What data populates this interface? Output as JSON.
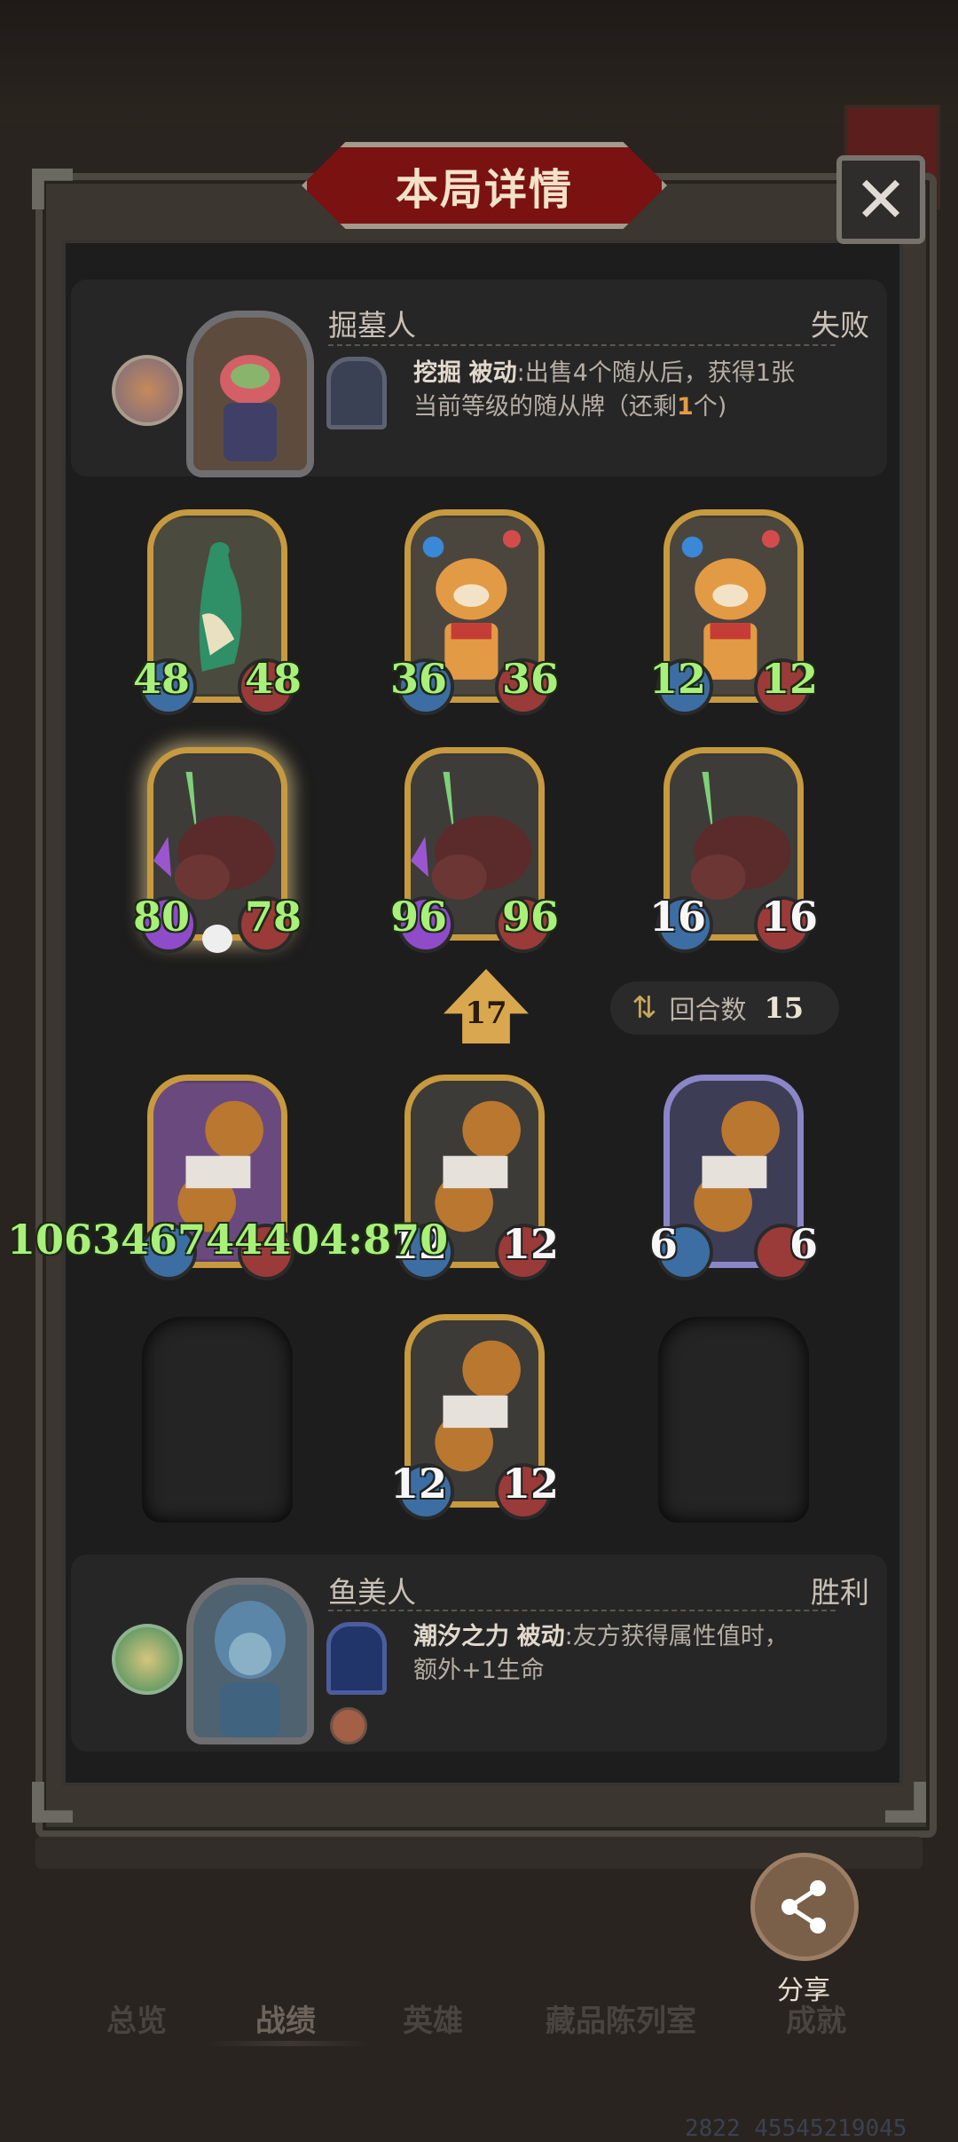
{
  "title": "本局详情",
  "close_label": "✕",
  "top_hero": {
    "name": "掘墓人",
    "result": "失败",
    "skill_name": "挖掘",
    "skill_type": "被动",
    "skill_text_1": ":出售4个随从后，获得1张",
    "skill_text_2a": "当前等级的随从牌（还剩",
    "skill_remaining": "1",
    "skill_text_2b": "个)"
  },
  "bottom_hero": {
    "name": "鱼美人",
    "result": "胜利",
    "skill_name": "潮汐之力",
    "skill_type": "被动",
    "skill_text_1": ":友方获得属性值时，",
    "skill_text_2": "额外+1生命"
  },
  "top_board": [
    {
      "atk": "48",
      "hp": "48",
      "color": "green"
    },
    {
      "atk": "36",
      "hp": "36",
      "color": "green"
    },
    {
      "atk": "12",
      "hp": "12",
      "color": "green"
    },
    {
      "atk": "80",
      "hp": "78",
      "color": "green"
    },
    {
      "atk": "96",
      "hp": "96",
      "color": "green"
    },
    {
      "atk": "16",
      "hp": "16",
      "color": "white"
    }
  ],
  "tier": "17",
  "round_label": "回合数",
  "round_value": "15",
  "bottom_board": [
    {
      "atk": "",
      "hp": "",
      "color": "green"
    },
    {
      "atk": "12",
      "hp": "12",
      "color": "white"
    },
    {
      "atk": "6",
      "hp": "6",
      "color": "white"
    },
    {
      "atk": "12",
      "hp": "12",
      "color": "white"
    }
  ],
  "overflow_stat": "106346744404:870",
  "share_label": "分享",
  "nav": [
    "总览",
    "战绩",
    "英雄",
    "藏品陈列室",
    "成就"
  ],
  "bottom_code": "2822 45545219045"
}
